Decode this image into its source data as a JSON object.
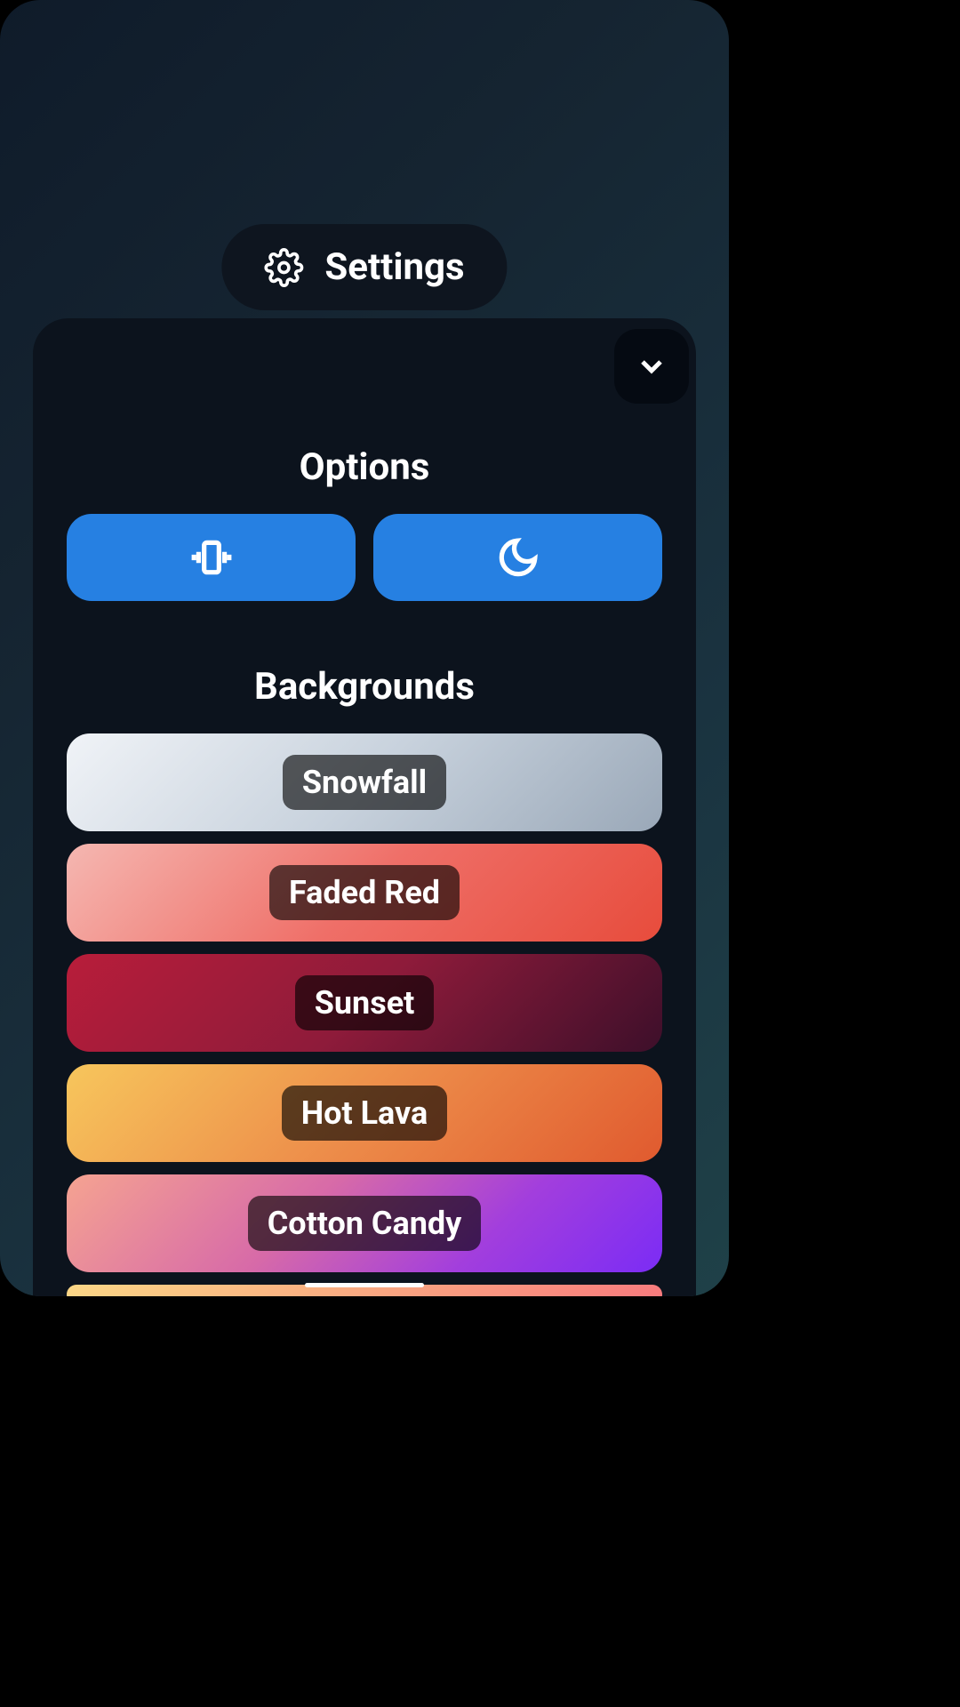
{
  "header": {
    "title": "Settings"
  },
  "panel": {
    "options": {
      "title": "Options",
      "items": [
        {
          "icon": "vibrate"
        },
        {
          "icon": "moon"
        }
      ]
    },
    "backgrounds": {
      "title": "Backgrounds",
      "items": [
        {
          "label": "Snowfall"
        },
        {
          "label": "Faded Red"
        },
        {
          "label": "Sunset"
        },
        {
          "label": "Hot Lava"
        },
        {
          "label": "Cotton Candy"
        }
      ]
    }
  },
  "colors": {
    "accent": "#2680e2",
    "panel_bg": "#0c131d",
    "badge_bg": "#0e151f"
  }
}
